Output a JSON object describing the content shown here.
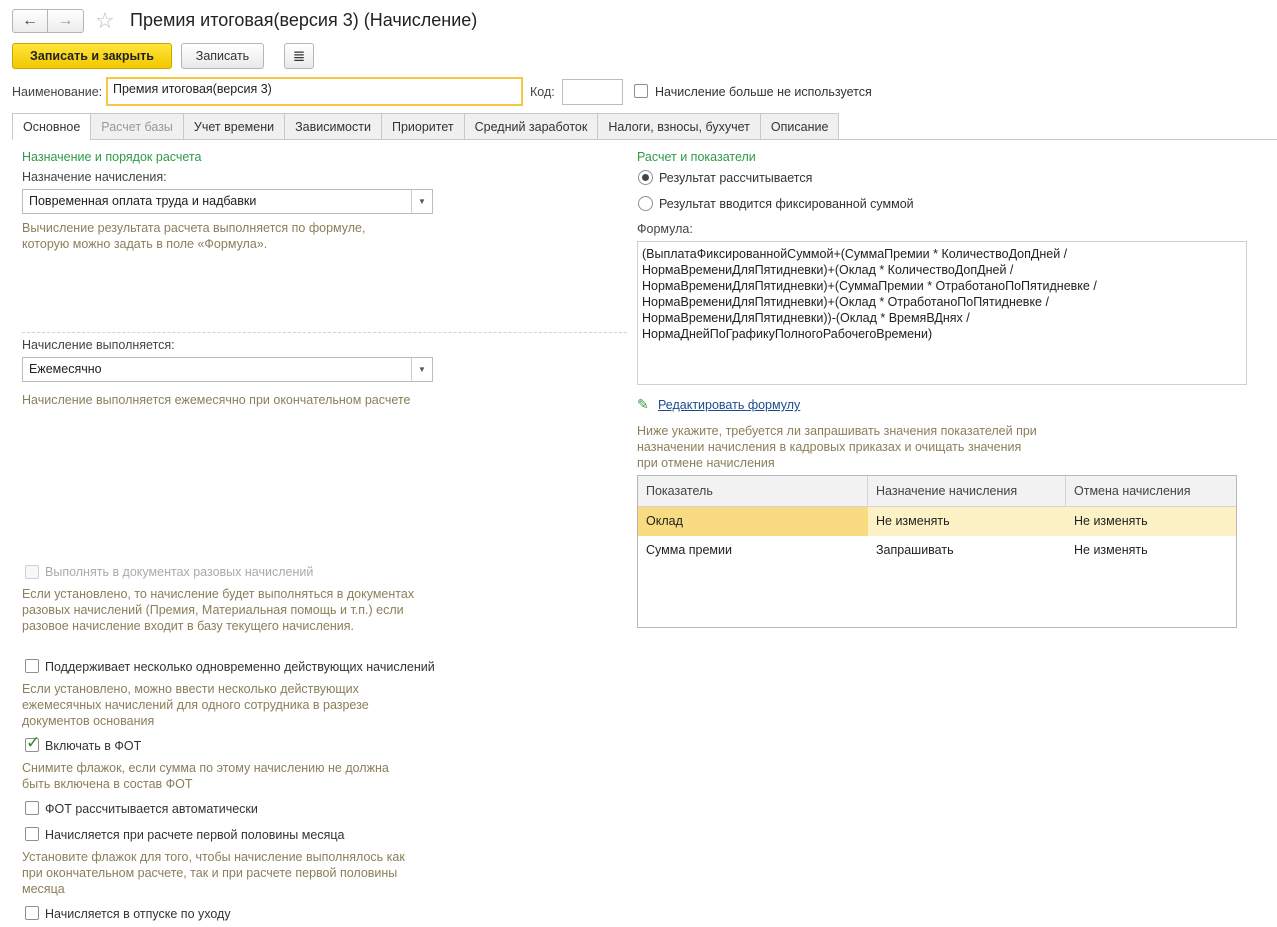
{
  "window": {
    "title": "Премия итоговая(версия 3) (Начисление)"
  },
  "nav": {
    "back_icon": "←",
    "forward_icon": "→",
    "star_icon": "☆"
  },
  "toolbar": {
    "save_close_label": "Записать и закрыть",
    "save_label": "Записать",
    "report_icon": "≣"
  },
  "form": {
    "name_label": "Наименование:",
    "name_value": "Премия итоговая(версия 3)",
    "code_label": "Код:",
    "code_value": "",
    "unused_label": "Начисление больше не используется"
  },
  "tabs": [
    {
      "label": "Основное",
      "state": "active"
    },
    {
      "label": "Расчет базы",
      "state": "disabled"
    },
    {
      "label": "Учет времени",
      "state": "normal"
    },
    {
      "label": "Зависимости",
      "state": "normal"
    },
    {
      "label": "Приоритет",
      "state": "normal"
    },
    {
      "label": "Средний заработок",
      "state": "normal"
    },
    {
      "label": "Налоги, взносы, бухучет",
      "state": "normal"
    },
    {
      "label": "Описание",
      "state": "normal"
    }
  ],
  "left": {
    "section_title": "Назначение и порядок расчета",
    "purpose_label": "Назначение начисления:",
    "purpose_value": "Повременная оплата труда и надбавки",
    "purpose_hint": "Вычисление результата расчета выполняется по формуле, которую можно задать в поле «Формула».",
    "exec_label": "Начисление выполняется:",
    "exec_value": "Ежемесячно",
    "exec_hint": "Начисление выполняется ежемесячно при окончательном расчете",
    "cb_onetime_label": "Выполнять в документах разовых начислений",
    "cb_onetime_hint": "Если установлено, то начисление будет выполняться в документах разовых начислений (Премия, Материальная помощь и т.п.) если разовое начисление входит в базу текущего начисления.",
    "cb_multi_label": "Поддерживает несколько одновременно действующих начислений",
    "cb_multi_hint": "Если установлено, можно ввести несколько действующих ежемесячных начислений для одного сотрудника в разрезе документов основания",
    "cb_fot_label": "Включать в ФОТ",
    "cb_fot_hint": "Снимите флажок, если сумма по этому начислению не должна быть включена в состав ФОТ",
    "cb_fot_auto_label": "ФОТ рассчитывается автоматически",
    "cb_half_label": "Начисляется при расчете первой половины месяца",
    "cb_half_hint": "Установите флажок для того, чтобы начисление выполнялось как при окончательном расчете, так и при расчете первой половины месяца",
    "cb_leave_label": "Начисляется в отпуске по уходу"
  },
  "right": {
    "section_title": "Расчет и показатели",
    "radio_calc_label": "Результат рассчитывается",
    "radio_fixed_label": "Результат вводится фиксированной суммой",
    "formula_label": "Формула:",
    "formula_text": "(ВыплатаФиксированнойСуммой+(СуммаПремии * КоличествоДопДней /\nНормаВремениДляПятидневки)+(Оклад * КоличествоДопДней /\nНормаВремениДляПятидневки)+(СуммаПремии * ОтработаноПоПятидневке /\nНормаВремениДляПятидневки)+(Оклад * ОтработаноПоПятидневке /\nНормаВремениДляПятидневки))-(Оклад * ВремяВДнях /\nНормаДнейПоГрафикуПолногоРабочегоВремени)",
    "edit_formula_label": "Редактировать формулу",
    "indicators_hint": "Ниже укажите, требуется ли запрашивать значения показателей при назначении начисления в кадровых приказах и очищать значения при отмене начисления",
    "table": {
      "headers": [
        "Показатель",
        "Назначение начисления",
        "Отмена начисления"
      ],
      "rows": [
        [
          "Оклад",
          "Не изменять",
          "Не изменять"
        ],
        [
          "Сумма премии",
          "Запрашивать",
          "Не изменять"
        ]
      ]
    }
  }
}
